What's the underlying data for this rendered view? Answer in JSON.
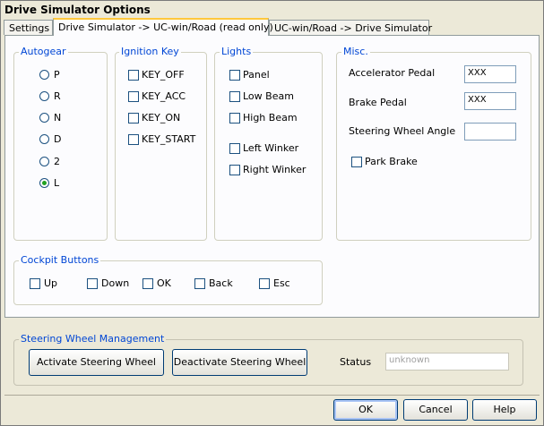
{
  "window": {
    "title": "Drive Simulator Options"
  },
  "tabs": [
    {
      "label": "Settings"
    },
    {
      "label": "Drive Simulator -> UC-win/Road (read only)"
    },
    {
      "label": "UC-win/Road -> Drive Simulator"
    }
  ],
  "autogear": {
    "title": "Autogear",
    "options": [
      "P",
      "R",
      "N",
      "D",
      "2",
      "L"
    ],
    "selected": "L"
  },
  "ignition": {
    "title": "Ignition Key",
    "items": [
      "KEY_OFF",
      "KEY_ACC",
      "KEY_ON",
      "KEY_START"
    ]
  },
  "lights": {
    "title": "Lights",
    "items": [
      "Panel",
      "Low Beam",
      "High Beam",
      "Left Winker",
      "Right Winker"
    ]
  },
  "misc": {
    "title": "Misc.",
    "accelerator_label": "Accelerator Pedal",
    "accelerator_value": "XXX",
    "brake_label": "Brake Pedal",
    "brake_value": "XXX",
    "steering_label": "Steering Wheel Angle",
    "steering_value": "",
    "park_brake_label": "Park Brake"
  },
  "cockpit": {
    "title": "Cockpit Buttons",
    "items": [
      "Up",
      "Down",
      "OK",
      "Back",
      "Esc"
    ]
  },
  "steering_mgmt": {
    "title": "Steering Wheel Management",
    "activate_label": "Activate Steering Wheel",
    "deactivate_label": "Deactivate Steering Wheel",
    "status_label": "Status",
    "status_value": "unknown"
  },
  "footer": {
    "ok": "OK",
    "cancel": "Cancel",
    "help": "Help"
  },
  "colors": {
    "group_label": "#0046d5",
    "active_tab_accent": "#ffc83c",
    "radio_selected": "#21a121"
  }
}
